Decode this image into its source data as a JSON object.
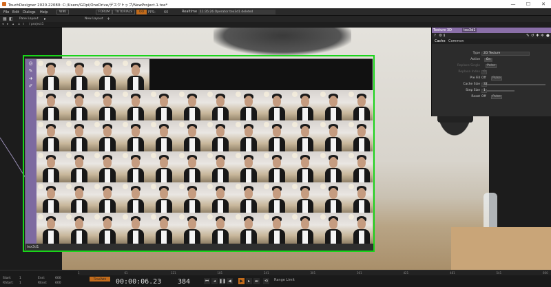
{
  "window": {
    "title": "TouchDesigner 2020.22080: C:/Users/GOpi/OneDrive/デスクトップ/NewProject.1.toe*",
    "minimize": "—",
    "maximize": "☐",
    "close": "✕"
  },
  "menubar": {
    "items": [
      "File",
      "Edit",
      "Dialogs",
      "Help"
    ],
    "wiki": "WIKI",
    "forum": "FORUM",
    "tutorials": "TUTORIALS",
    "oo": "OO",
    "fps_label": "FPS:",
    "fps_value": "60",
    "realtime": "Realtime",
    "console": "11:35:26 Operator tex3d1 deleted"
  },
  "tabbar": {
    "pane_layout": "Pane Layout",
    "new_layout": "New Layout",
    "add": "+"
  },
  "pathbar": {
    "path": "/ project1"
  },
  "node": {
    "name": "tex3d1",
    "rows": 6,
    "columns": 12,
    "first_row_tiles": 4
  },
  "params": {
    "op_type": "Texture 3D",
    "op_name": "tex3d1",
    "tabs": [
      "Cache",
      "Common"
    ],
    "rows": [
      {
        "label": "Type",
        "value": "2D Texture",
        "kind": "menu",
        "dim": false
      },
      {
        "label": "Active",
        "value": "On",
        "kind": "toggle",
        "dim": false
      },
      {
        "label": "Replace Single",
        "value": "Pulse",
        "kind": "pulse",
        "dim": true
      },
      {
        "label": "Replace Index",
        "value": "0",
        "kind": "value",
        "dim": true
      },
      {
        "label": "Pre Fill",
        "value": "Off",
        "kind": "toggle-pulse",
        "pulse": "Pulse",
        "dim": false
      },
      {
        "label": "Cache Size",
        "value": "32",
        "kind": "slider",
        "dim": false
      },
      {
        "label": "Step Size",
        "value": "1",
        "kind": "slider",
        "dim": false
      },
      {
        "label": "Reset",
        "value": "Off",
        "kind": "toggle-pulse",
        "pulse": "Pulse",
        "dim": false
      }
    ]
  },
  "timeline": {
    "start_label": "Start:",
    "start_value": "1",
    "end_label": "End:",
    "end_value": "600",
    "rstart_label": "RStart:",
    "rstart_value": "1",
    "rend_label": "REnd:",
    "rend_value": "600",
    "timepath": "TimePath",
    "timecode": "00:00:06.23",
    "frame": "384",
    "range_limit": "Range Limit",
    "ruler_ticks": [
      "1",
      "61",
      "121",
      "181",
      "241",
      "301",
      "361",
      "421",
      "481",
      "541",
      "600"
    ]
  }
}
